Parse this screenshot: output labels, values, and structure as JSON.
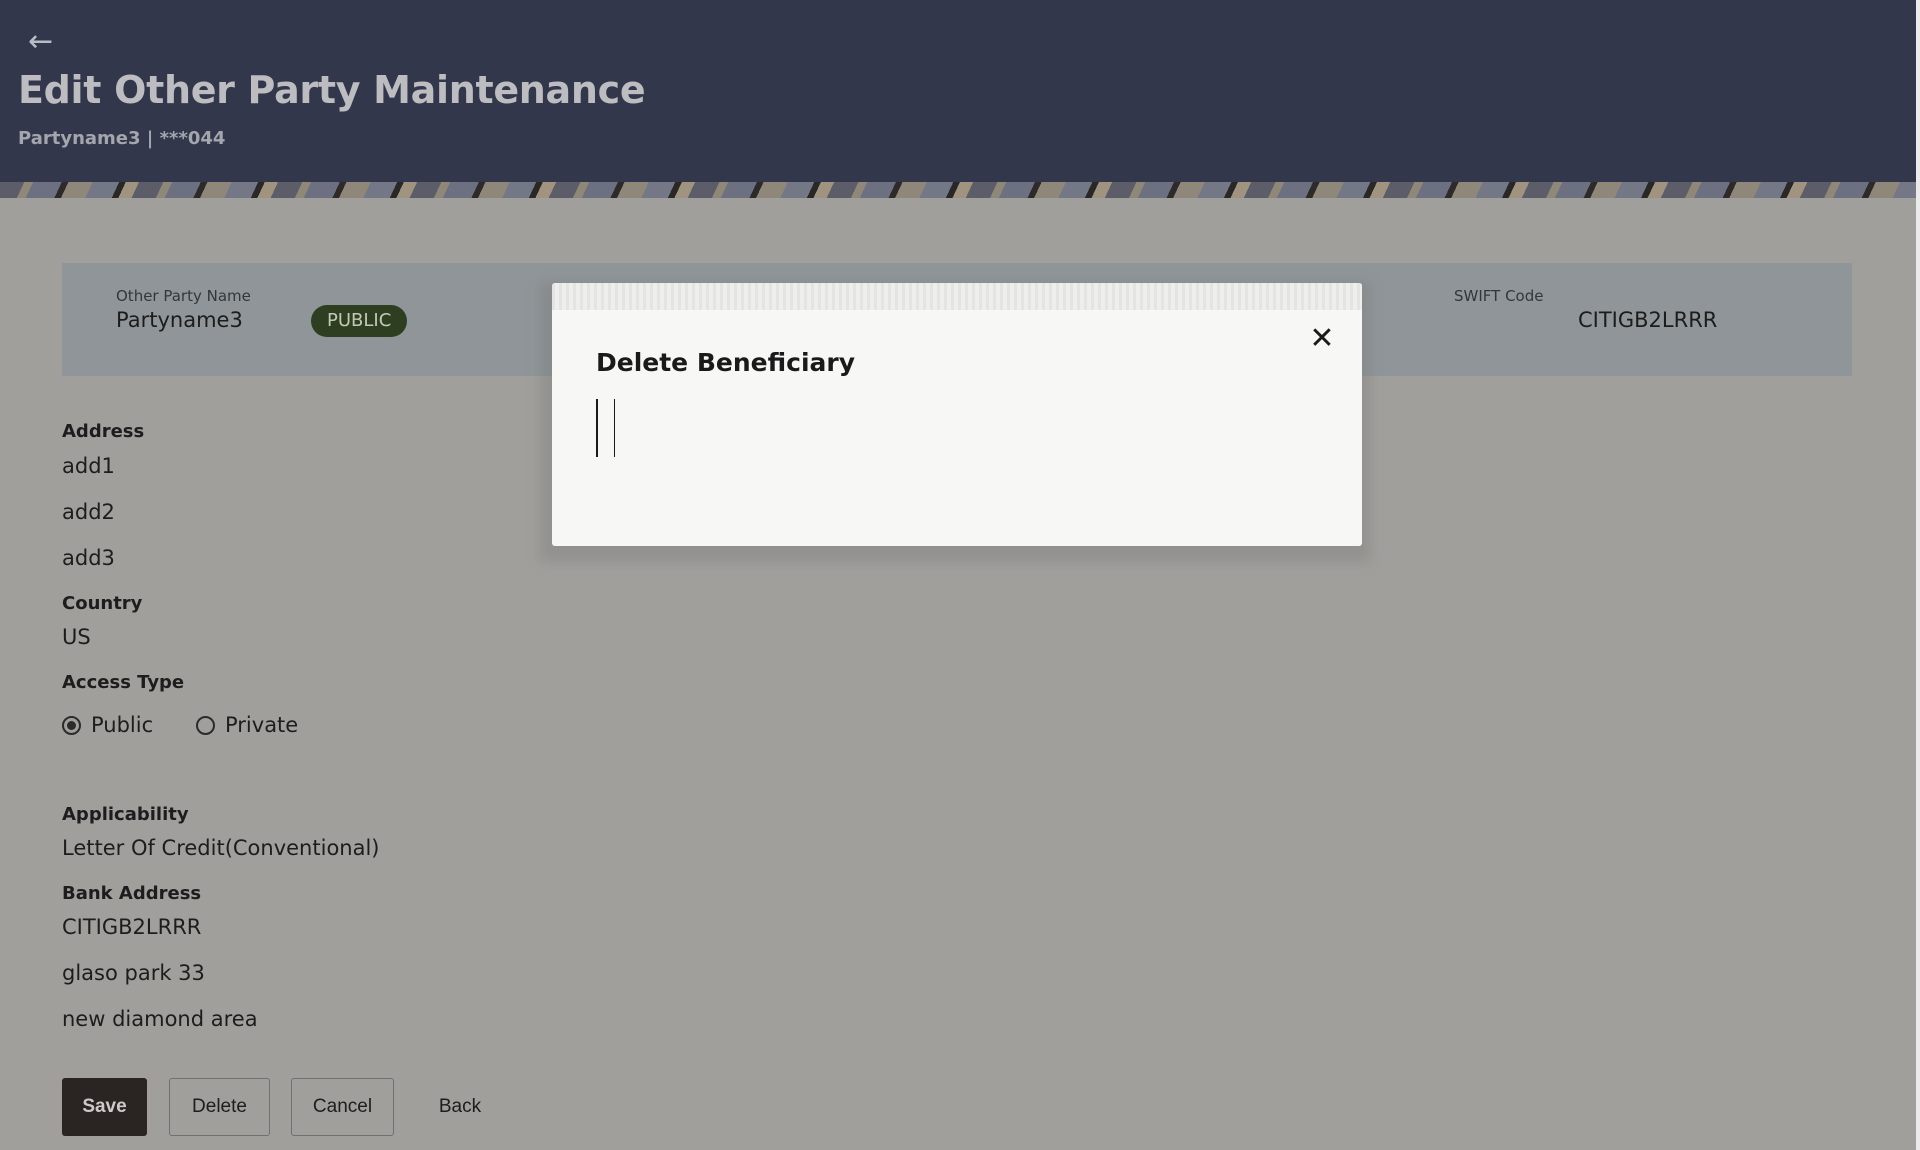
{
  "header": {
    "back_icon": "arrow-left-icon",
    "title": "Edit Other Party Maintenance",
    "subtitle": "Partyname3 | ***044"
  },
  "summary": {
    "party_name_label": "Other Party Name",
    "party_name": "Partyname3",
    "access_badge": "PUBLIC",
    "swift_label": "SWIFT Code",
    "swift_code": "CITIGB2LRRR"
  },
  "details": {
    "address_label": "Address",
    "address_lines": [
      "add1",
      "add2",
      "add3"
    ],
    "country_label": "Country",
    "country": "US",
    "access_type_label": "Access Type",
    "access_options": [
      {
        "label": "Public",
        "selected": true
      },
      {
        "label": "Private",
        "selected": false
      }
    ],
    "applicability_label": "Applicability",
    "applicability": "Letter Of Credit(Conventional)",
    "bank_address_label": "Bank Address",
    "bank_address_lines": [
      "CITIGB2LRRR",
      "glaso park 33",
      "new diamond area"
    ]
  },
  "actions": {
    "save": "Save",
    "delete": "Delete",
    "cancel": "Cancel",
    "back": "Back"
  },
  "modal": {
    "title": "Delete Beneficiary",
    "close_icon": "close-icon"
  }
}
